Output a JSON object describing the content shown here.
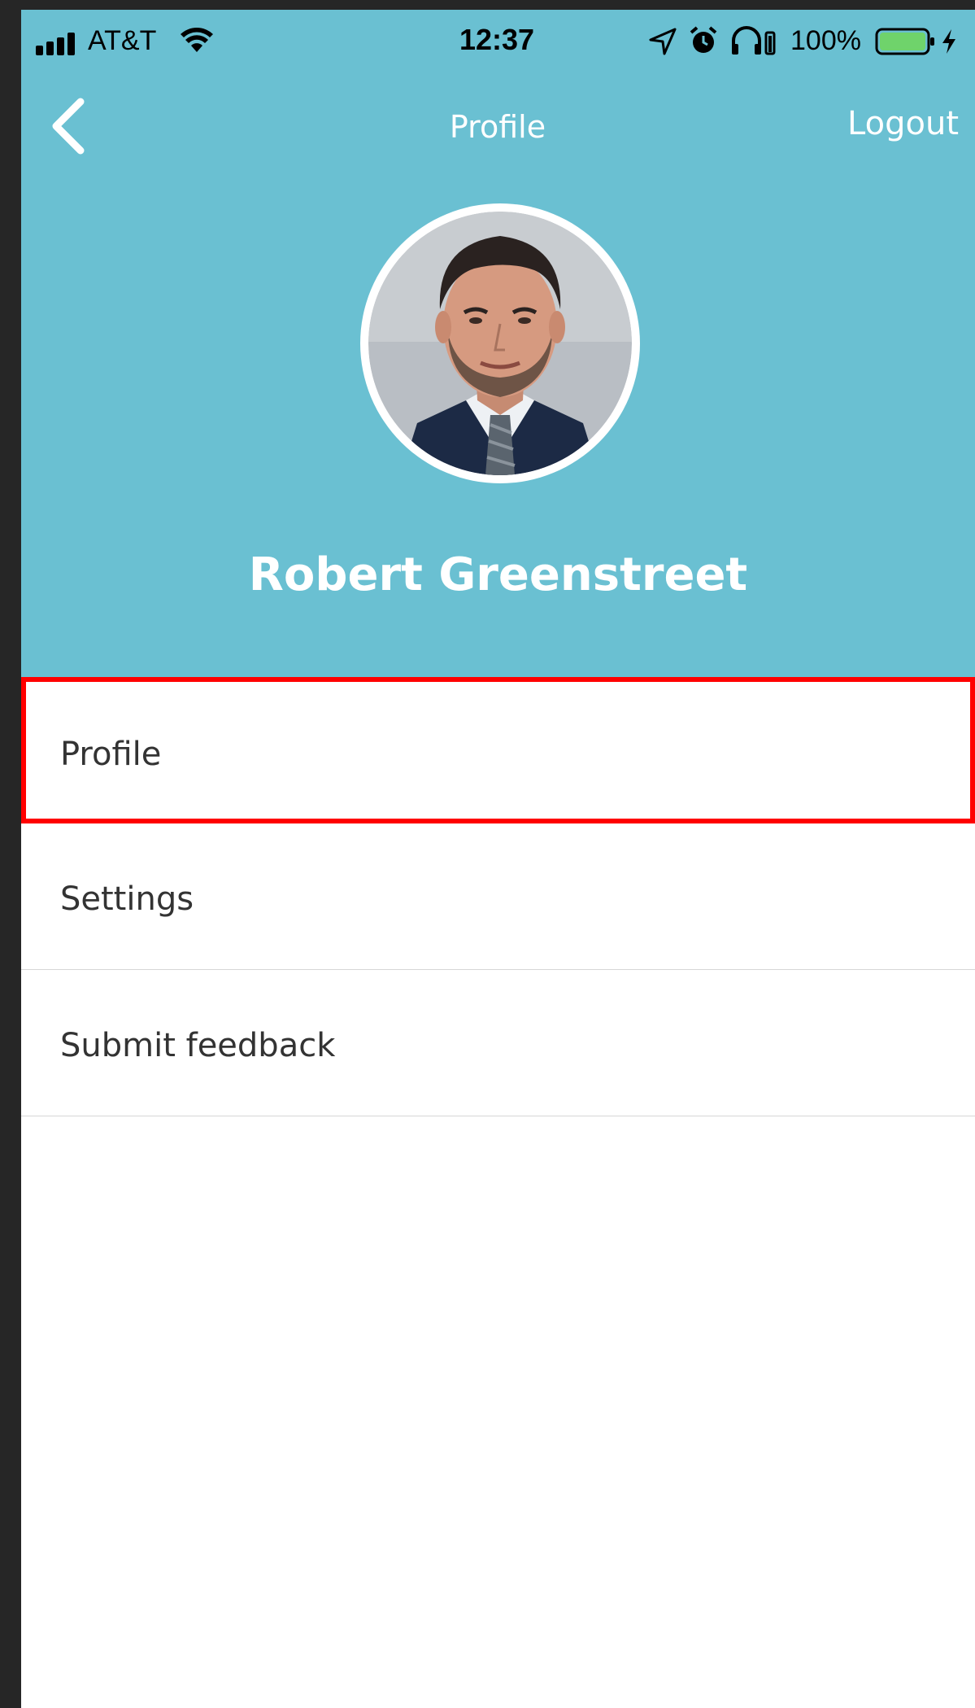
{
  "status_bar": {
    "carrier": "AT&T",
    "time": "12:37",
    "battery_percent": "100%",
    "signal_icon": "signal-bars-icon",
    "wifi_icon": "wifi-icon",
    "location_icon": "location-arrow-icon",
    "alarm_icon": "alarm-clock-icon",
    "headphone_icon": "headphones-battery-icon",
    "battery_icon": "battery-icon",
    "charging_icon": "charging-bolt-icon"
  },
  "nav": {
    "title": "Profile",
    "logout_label": "Logout",
    "back_icon": "chevron-left-icon"
  },
  "profile": {
    "name": "Robert Greenstreet",
    "avatar_icon": "profile-photo"
  },
  "menu": {
    "items": [
      {
        "label": "Profile"
      },
      {
        "label": "Settings"
      },
      {
        "label": "Submit feedback"
      }
    ]
  },
  "colors": {
    "header": "#6ac0d2",
    "highlight": "#ff0000",
    "battery_fill": "#6fd36b",
    "frame": "#262626"
  }
}
